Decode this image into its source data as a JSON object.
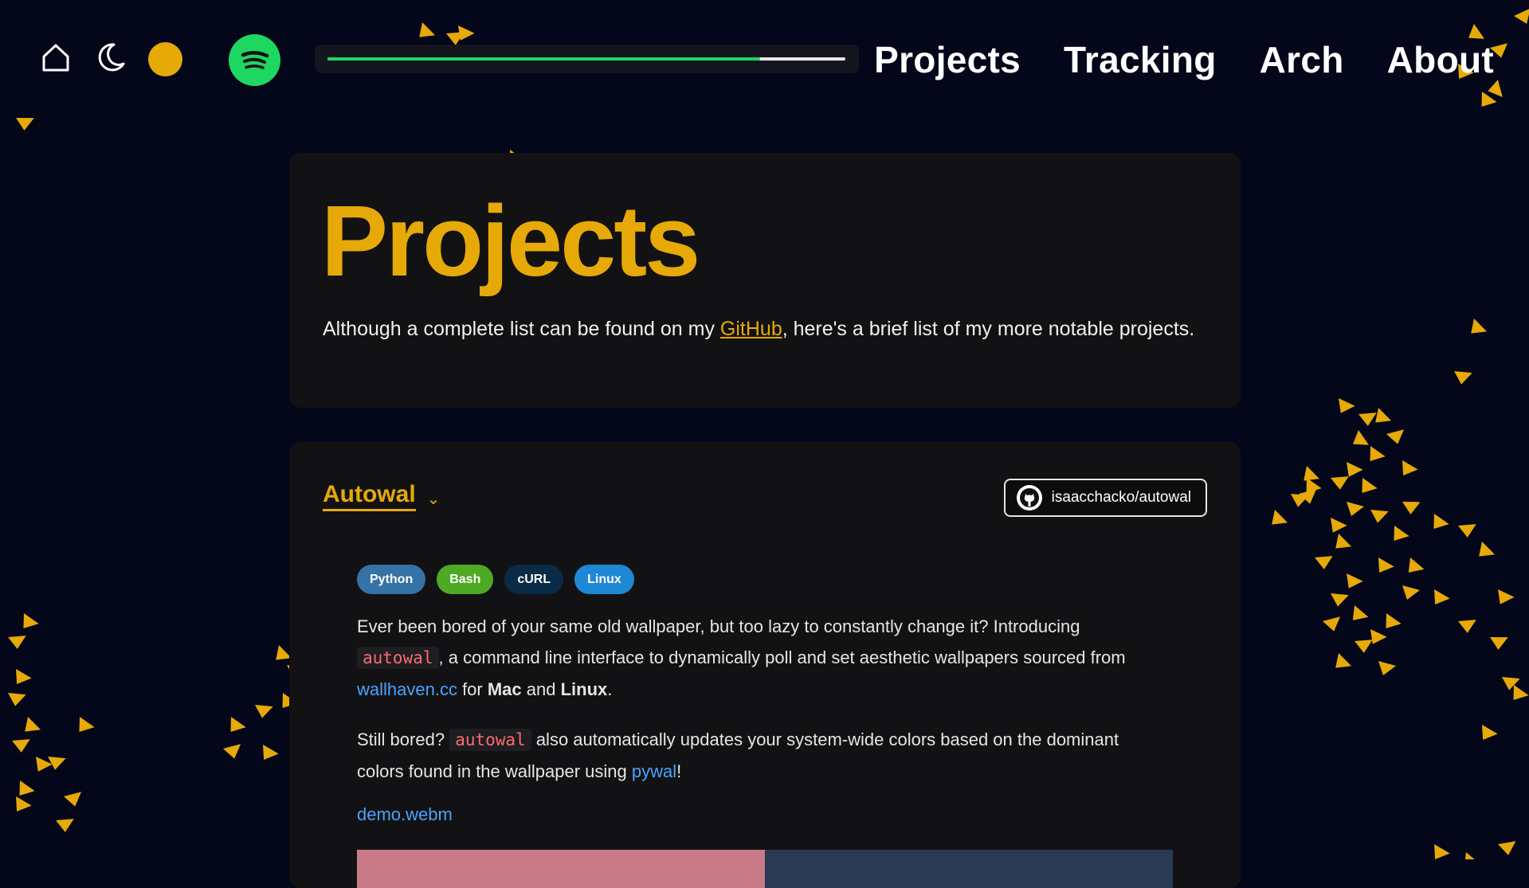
{
  "header": {
    "home_icon": "home-icon",
    "theme_icon": "moon-icon",
    "spotify_icon": "spotify-icon",
    "player_progress": 0.835,
    "nav": [
      "Projects",
      "Tracking",
      "Arch",
      "About"
    ]
  },
  "hero": {
    "title": "Projects",
    "text_before": "Although a complete list can be found on my ",
    "github_link": "GitHub",
    "text_after": ", here's a brief list of my more notable projects."
  },
  "project": {
    "title": "Autowal",
    "chevron": "⌄",
    "repo": "isaacchacko/autowal",
    "tags": [
      "Python",
      "Bash",
      "cURL",
      "Linux"
    ],
    "p1_a": "Ever been bored of your same old wallpaper, but too lazy to constantly change it? Introducing ",
    "p1_code": "autowal",
    "p1_b": ", a command line interface to dynamically poll and set aesthetic wallpapers sourced from ",
    "p1_link": "wallhaven.cc",
    "p1_c": " for ",
    "p1_mac": "Mac",
    "p1_d": " and ",
    "p1_linux": "Linux",
    "p1_e": ".",
    "p2_a": "Still bored? ",
    "p2_code": "autowal",
    "p2_b": " also automatically updates your system-wide colors based on the dominant colors found in the wallpaper using ",
    "p2_link": "pywal",
    "p2_c": "!",
    "demo": "demo.webm"
  },
  "colors": {
    "accent": "#e6a908",
    "background": "#04061a",
    "card": "#121214",
    "spotify": "#1ed760",
    "link": "#4aa3ff"
  }
}
